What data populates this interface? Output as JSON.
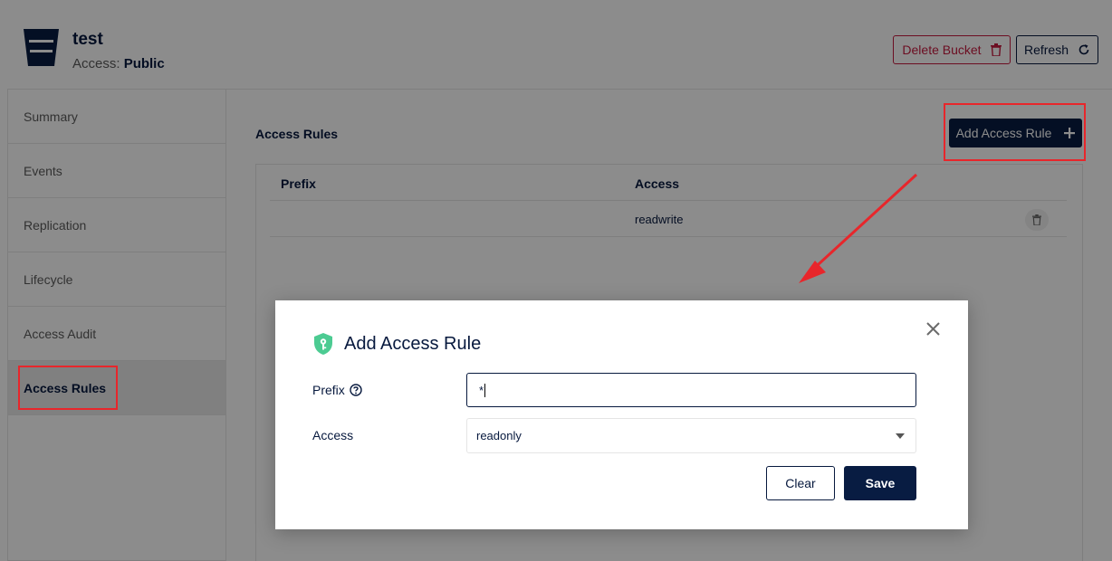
{
  "header": {
    "title": "test",
    "access_label": "Access:",
    "access_value": "Public",
    "delete_button": "Delete Bucket",
    "refresh_button": "Refresh"
  },
  "sidebar": {
    "items": [
      {
        "label": "Summary"
      },
      {
        "label": "Events"
      },
      {
        "label": "Replication"
      },
      {
        "label": "Lifecycle"
      },
      {
        "label": "Access Audit"
      },
      {
        "label": "Access Rules"
      }
    ],
    "active_item": "Access Rules"
  },
  "main": {
    "section_title": "Access Rules",
    "add_button": "Add Access Rule",
    "table": {
      "columns": [
        "Prefix",
        "Access"
      ],
      "rows": [
        {
          "prefix": "",
          "access": "readwrite"
        }
      ]
    }
  },
  "modal": {
    "title": "Add Access Rule",
    "prefix_label": "Prefix",
    "prefix_value": "*",
    "access_label": "Access",
    "access_value": "readonly",
    "clear_button": "Clear",
    "save_button": "Save"
  },
  "colors": {
    "primary": "#081c42",
    "danger": "#c51b3f",
    "shield": "#4ccb92",
    "annotation": "#e8262b"
  },
  "icons": {
    "bucket": "bucket-icon",
    "delete": "trash-icon",
    "refresh": "refresh-icon",
    "add": "plus-icon",
    "close": "close-icon",
    "shield": "shield-key-icon",
    "help": "help-circle-icon",
    "dropdown": "chevron-down-icon"
  }
}
